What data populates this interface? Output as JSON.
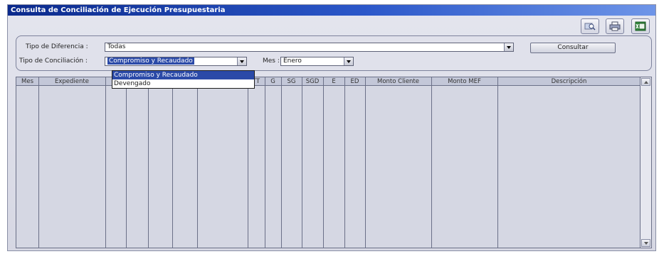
{
  "window": {
    "title": "Consulta de Conciliación de Ejecución Presupuestaria"
  },
  "toolbar": {
    "icons": [
      "search-icon",
      "print-icon",
      "excel-icon"
    ]
  },
  "filters": {
    "tipo_diferencia_label": "Tipo de Diferencia :",
    "tipo_diferencia_value": "Todas",
    "tipo_conciliacion_label": "Tipo de Conciliación :",
    "tipo_conciliacion_value": "Compromiso y Recaudado",
    "mes_label": "Mes :",
    "mes_value": "Enero",
    "consultar_label": "Consultar"
  },
  "dropdown": {
    "options": [
      "Compromiso y Recaudado",
      "Devengado"
    ]
  },
  "grid": {
    "columns": [
      "Mes",
      "Expediente",
      "",
      "",
      "",
      "",
      "",
      "TT",
      "G",
      "SG",
      "SGD",
      "E",
      "ED",
      "Monto Cliente",
      "Monto MEF",
      "Descripción"
    ]
  },
  "colors": {
    "title_bar": "#0b2a8c",
    "selection": "#2b4aa8",
    "window_bg": "#dcdde8"
  }
}
